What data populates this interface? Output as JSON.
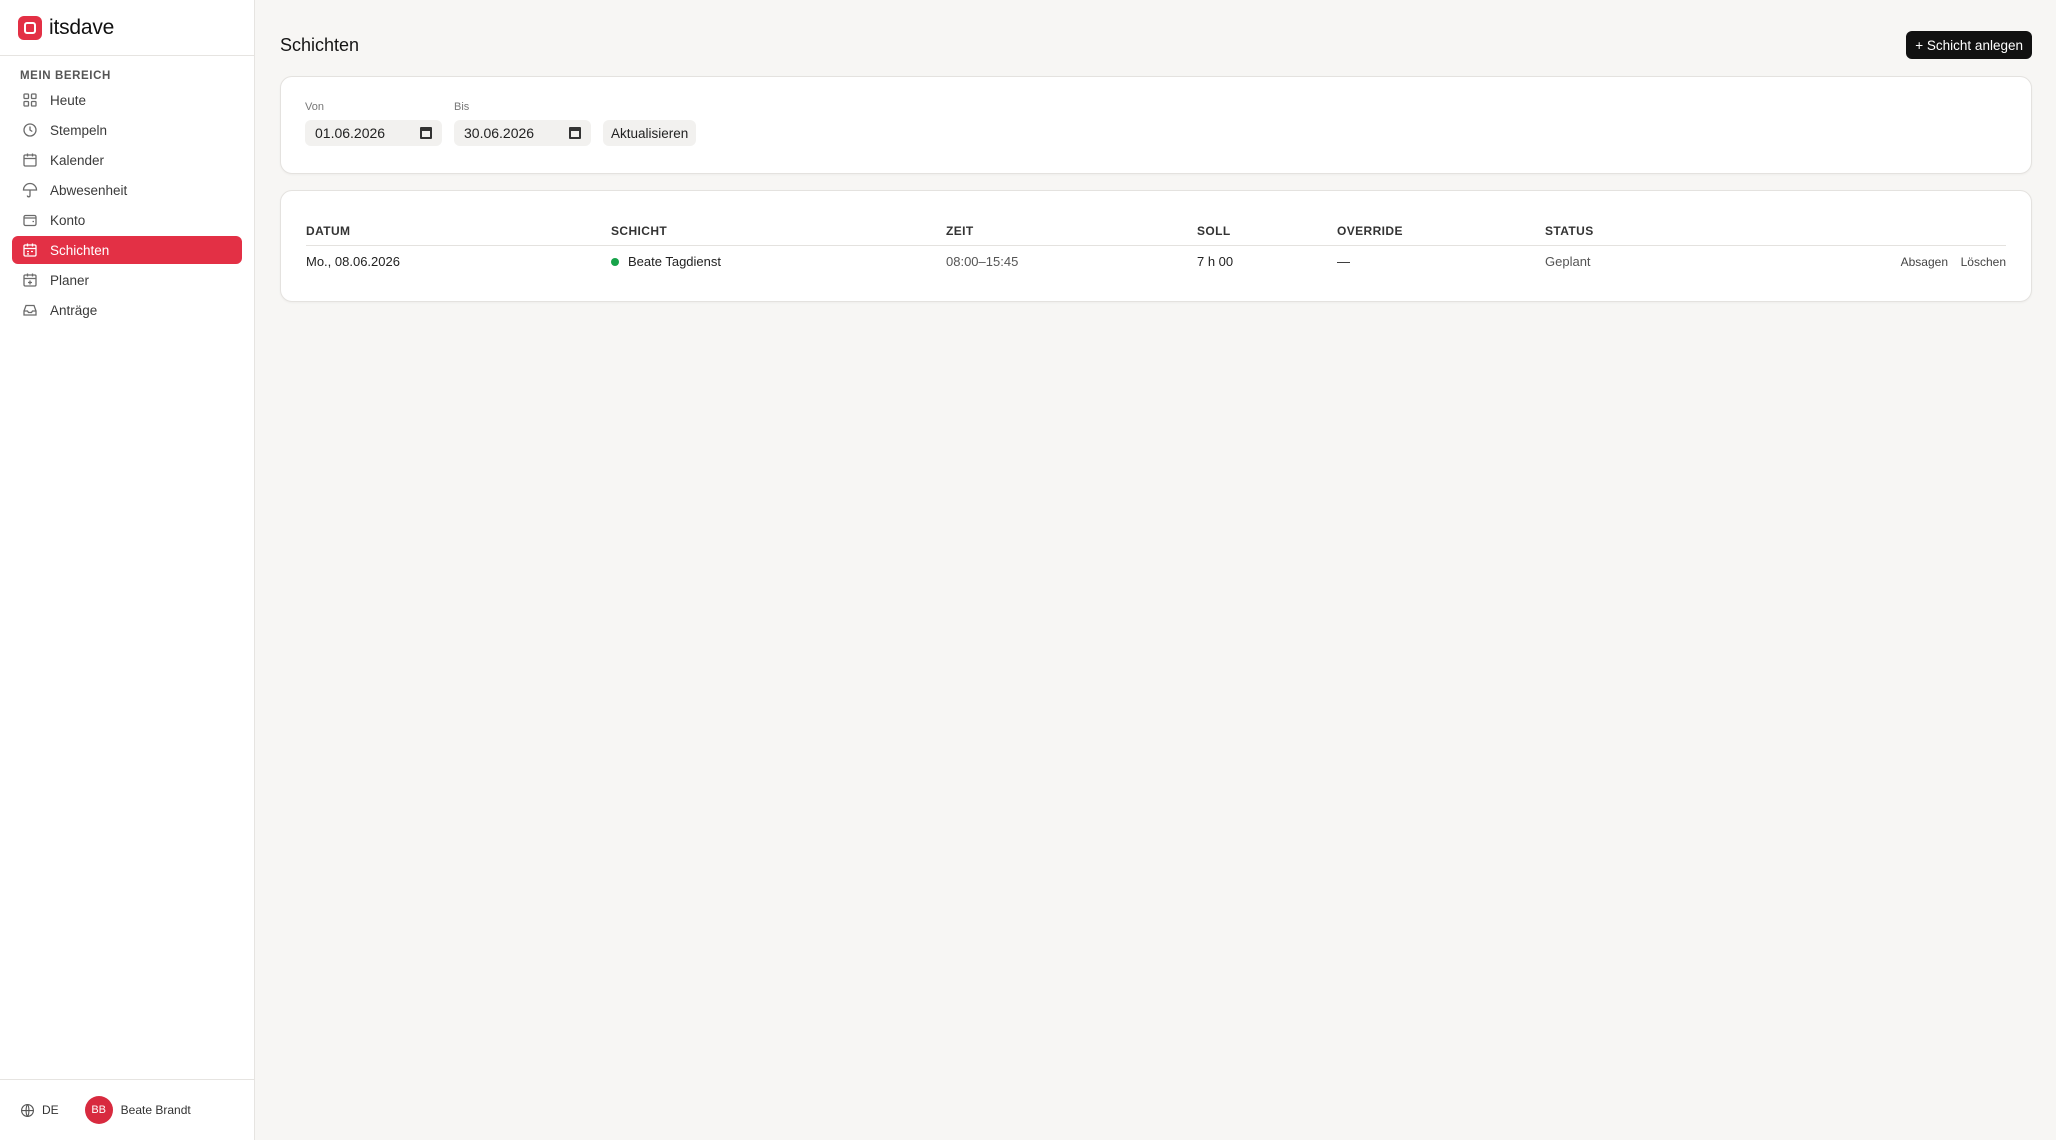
{
  "brand": {
    "name": "itsdave",
    "accent": "#e33045"
  },
  "sidebar": {
    "section": "MEIN BEREICH",
    "items": [
      {
        "label": "Heute",
        "icon": "grid-icon"
      },
      {
        "label": "Stempeln",
        "icon": "clock-icon"
      },
      {
        "label": "Kalender",
        "icon": "calendar-icon"
      },
      {
        "label": "Abwesenheit",
        "icon": "umbrella-icon"
      },
      {
        "label": "Konto",
        "icon": "wallet-icon"
      },
      {
        "label": "Schichten",
        "icon": "calendar-shift-icon",
        "active": true
      },
      {
        "label": "Planer",
        "icon": "calendar-plus-icon"
      },
      {
        "label": "Anträge",
        "icon": "inbox-icon"
      }
    ],
    "footer": {
      "language": "DE",
      "user_initials": "BB",
      "user_name": "Beate Brandt"
    }
  },
  "page": {
    "title": "Schichten",
    "create_button": "+ Schicht anlegen"
  },
  "filters": {
    "from_label": "Von",
    "from_value": "01.06.2026",
    "to_label": "Bis",
    "to_value": "30.06.2026",
    "refresh_label": "Aktualisieren"
  },
  "table": {
    "columns": [
      "DATUM",
      "SCHICHT",
      "ZEIT",
      "SOLL",
      "OVERRIDE",
      "STATUS"
    ],
    "rows": [
      {
        "datum": "Mo., 08.06.2026",
        "schicht": "Beate Tagdienst",
        "zeit": "08:00–15:45",
        "soll": "7 h 00",
        "override": "—",
        "status": "Geplant",
        "status_color": "#17a34a",
        "action_cancel": "Absagen",
        "action_delete": "Löschen"
      }
    ]
  }
}
